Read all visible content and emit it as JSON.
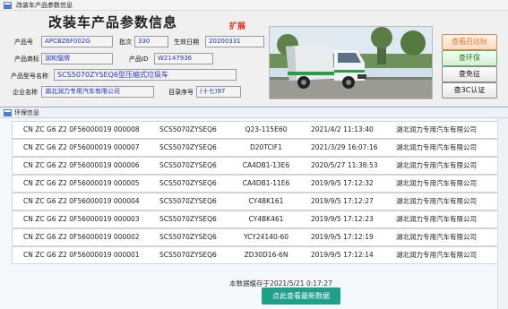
{
  "main_window": {
    "title": "改装车产品参数信息",
    "heading": "改装车产品参数信息",
    "expand_label": "扩展",
    "fields": {
      "product_no_label": "产品号",
      "product_no": "APCBZ6F002G",
      "batch_label": "批次",
      "batch": "330",
      "effective_date_label": "生效日期",
      "effective_date": "20200331",
      "brand_label": "产品商标",
      "brand": "润和璧牌",
      "product_id_label": "产品ID",
      "product_id": "W2147936",
      "model_name_label": "产品型号名称",
      "model_name": "SCS5070ZYSEQ6型压缩式垃圾车",
      "company_label": "企业名称",
      "company": "湖北润力专用汽车有限公司",
      "catalog_no_label": "目录序号",
      "catalog_no": "(十七)97"
    },
    "buttons": {
      "view_recall": "查看召达标",
      "check_env": "查环保",
      "check_exempt": "查免征",
      "check_3c": "查3C认证"
    }
  },
  "env_dialog": {
    "title": "环保信息",
    "rows": [
      {
        "vin": "CN ZC G6 Z2 0F56000019 000008",
        "model": "SCS5070ZYSEQ6",
        "engine": "Q23-115E60",
        "time": "2021/4/2 11:13:40",
        "company": "湖北润力专用汽车有限公司"
      },
      {
        "vin": "CN ZC G6 Z2 0F56000019 000007",
        "model": "SCS5070ZYSEQ6",
        "engine": "D20TCIF1",
        "time": "2021/3/29 16:07:16",
        "company": "湖北润力专用汽车有限公司"
      },
      {
        "vin": "CN ZC G6 Z2 0F56000019 000006",
        "model": "SCS5070ZYSEQ6",
        "engine": "CA4DB1-13E6",
        "time": "2020/5/27 11:38:53",
        "company": "湖北润力专用汽车有限公司"
      },
      {
        "vin": "CN ZC G6 Z2 0F56000019 000005",
        "model": "SCS5070ZYSEQ6",
        "engine": "CA4DB1-11E6",
        "time": "2019/9/5 17:12:32",
        "company": "湖北润力专用汽车有限公司"
      },
      {
        "vin": "CN ZC G6 Z2 0F56000019 000004",
        "model": "SCS5070ZYSEQ6",
        "engine": "CY4BK161",
        "time": "2019/9/5 17:12:27",
        "company": "湖北润力专用汽车有限公司"
      },
      {
        "vin": "CN ZC G6 Z2 0F56000019 000003",
        "model": "SCS5070ZYSEQ6",
        "engine": "CY4BK461",
        "time": "2019/9/5 17:12:23",
        "company": "湖北润力专用汽车有限公司"
      },
      {
        "vin": "CN ZC G6 Z2 0F56000019 000002",
        "model": "SCS5070ZYSEQ6",
        "engine": "YCY24140-60",
        "time": "2019/9/5 17:12:19",
        "company": "湖北润力专用汽车有限公司"
      },
      {
        "vin": "CN ZC G6 Z2 0F56000019 000001",
        "model": "SCS5070ZYSEQ6",
        "engine": "ZD30D16-6N",
        "time": "2019/9/5 17:12:14",
        "company": "湖北润力专用汽车有限公司"
      }
    ],
    "cache_note": "本数据缓存于2021/5/21 0:17:27",
    "refresh_button": "点此查看最新数据"
  }
}
